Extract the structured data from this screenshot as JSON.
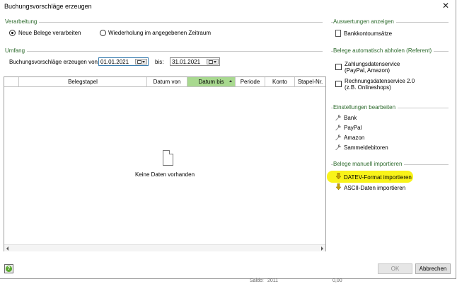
{
  "window": {
    "title": "Buchungsvorschläge erzeugen",
    "close_glyph": "✕"
  },
  "verarbeitung": {
    "label": "Verarbeitung",
    "option_new": "Neue Belege verarbeiten",
    "option_repeat": "Wiederholung im angegebenen Zeitraum",
    "selected": "option_new"
  },
  "umfang": {
    "label": "Umfang",
    "from_label": "Buchungsvorschläge erzeugen von:",
    "from_value": "01.01.2021",
    "to_label": "bis:",
    "to_value": "31.01.2021"
  },
  "table": {
    "columns": [
      "Belegstapel",
      "Datum von",
      "Datum bis",
      "Periode",
      "Konto",
      "Stapel-Nr."
    ],
    "sorted_column": "Datum bis",
    "empty_text": "Keine Daten vorhanden"
  },
  "auswertungen": {
    "label": "Auswertungen anzeigen",
    "items": [
      "Bankkontoumsätze"
    ]
  },
  "auto_abholen": {
    "label": "Belege automatisch abholen (Referent)",
    "items": [
      {
        "line1": "Zahlungsdatenservice",
        "line2": "(PayPal, Amazon)"
      },
      {
        "line1": "Rechnungsdatenservice 2.0",
        "line2": "(z.B. Onlineshops)"
      }
    ]
  },
  "einstellungen": {
    "label": "Einstellungen bearbeiten",
    "items": [
      "Bank",
      "PayPal",
      "Amazon",
      "Sammeldebitoren"
    ]
  },
  "manuell": {
    "label": "Belege manuell importieren",
    "items": [
      "DATEV-Format importieren",
      "ASCII-Daten importieren"
    ],
    "highlight_color": "#f8f200"
  },
  "footer": {
    "help_glyph": "?",
    "ok_label": "OK",
    "cancel_label": "Abbrechen"
  },
  "background_fragments": [
    "Saldo:",
    "2011",
    "0,00"
  ],
  "colors": {
    "group_label": "#2c6a2c",
    "sorted_header": "#a8d98f",
    "help_icon": "#5aa82e"
  }
}
